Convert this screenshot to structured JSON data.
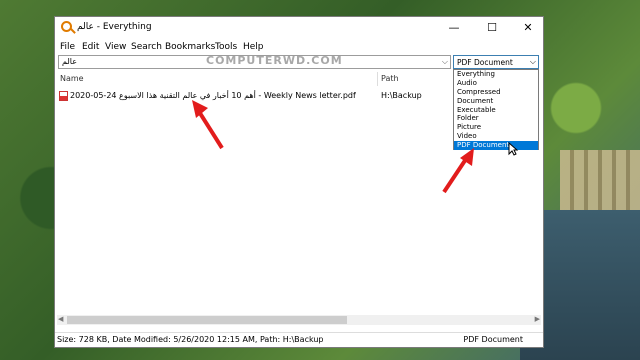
{
  "window": {
    "title": "عالم - Everything",
    "controls": {
      "minimize": "—",
      "maximize": "☐",
      "close": "✕"
    }
  },
  "menu": [
    "File",
    "Edit",
    "View",
    "Search",
    "Bookmarks",
    "Tools",
    "Help"
  ],
  "search": {
    "value": "عالم",
    "dropdown_icon": "chevron-down"
  },
  "filter": {
    "selected": "PDF Document",
    "options": [
      "Everything",
      "Audio",
      "Compressed",
      "Document",
      "Executable",
      "Folder",
      "Picture",
      "Video",
      "PDF Document"
    ]
  },
  "columns": {
    "name": "Name",
    "path": "Path"
  },
  "results": [
    {
      "name": "2020-05-24 أهم 10 أخبار في عالم التقنية هذا الاسبوع - Weekly News letter.pdf",
      "path": "H:\\Backup",
      "icon": "pdf-icon"
    }
  ],
  "status": {
    "left": "Size: 728 KB, Date Modified: 5/26/2020 12:15 AM, Path: H:\\Backup",
    "right": "PDF Document"
  },
  "watermark": "COMPUTERWD.COM",
  "colors": {
    "accent": "#0078d7",
    "arrow": "#e21c1c"
  }
}
